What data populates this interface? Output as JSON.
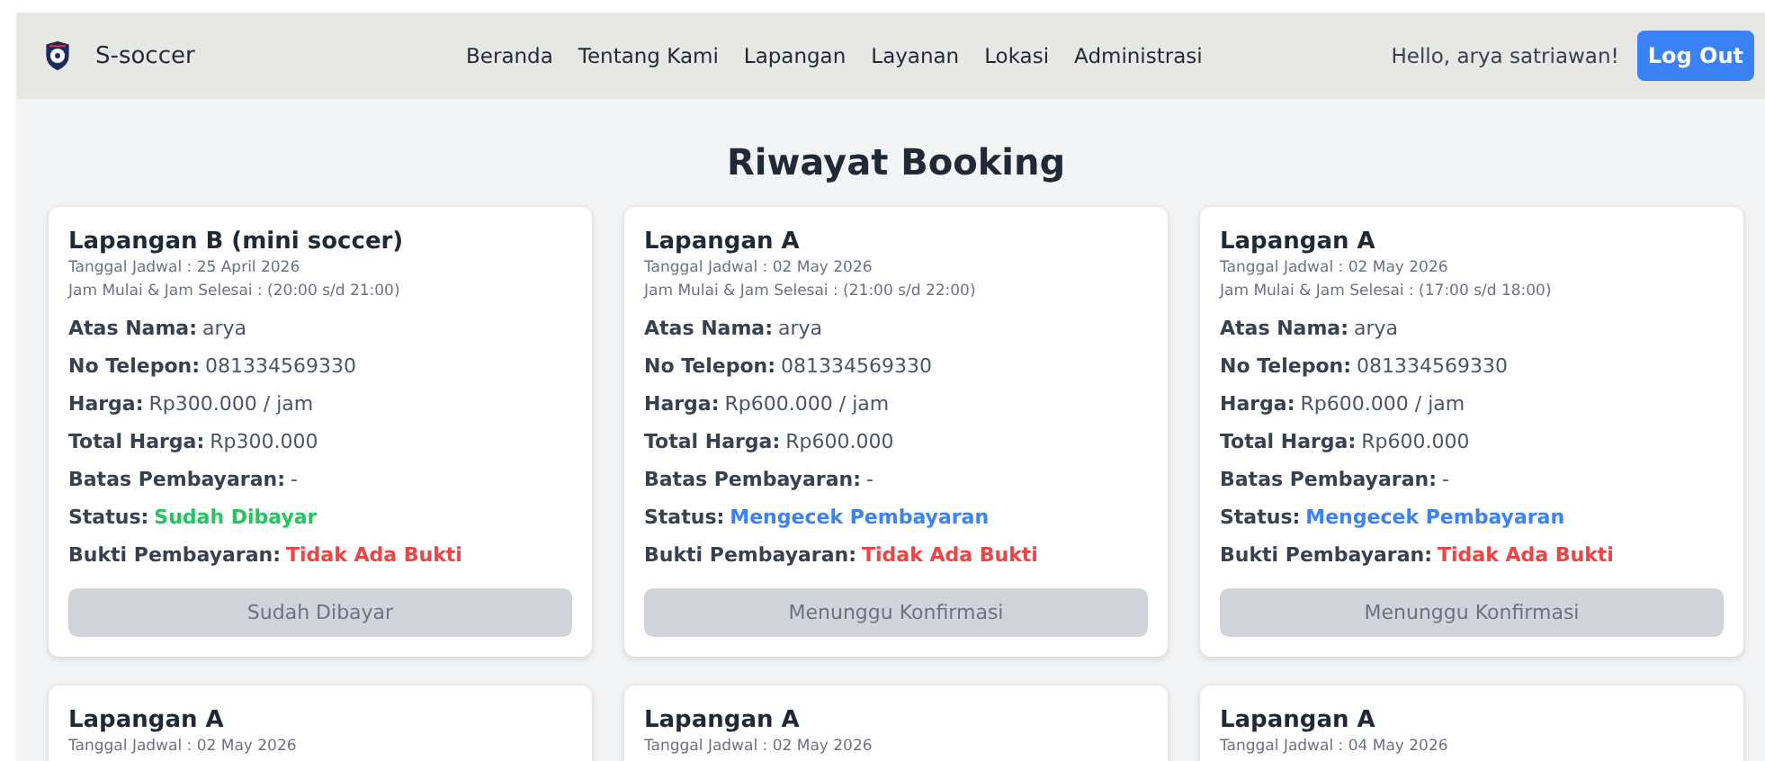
{
  "navbar": {
    "brand": "S-soccer",
    "links": [
      "Beranda",
      "Tentang Kami",
      "Lapangan",
      "Layanan",
      "Lokasi",
      "Administrasi"
    ],
    "greeting": "Hello, arya satriawan!",
    "logout": "Log Out"
  },
  "title": "Riwayat Booking",
  "cards": [
    {
      "title": "Lapangan B (mini soccer)",
      "date": "Tanggal Jadwal : 25 April 2026",
      "time": "Jam Mulai & Jam Selesai : (20:00 s/d 21:00)",
      "fields": [
        {
          "label": "Atas Nama:",
          "value": "arya"
        },
        {
          "label": "No Telepon:",
          "value": "081334569330"
        },
        {
          "label": "Harga:",
          "value": "Rp300.000 / jam"
        },
        {
          "label": "Total Harga:",
          "value": "Rp300.000"
        },
        {
          "label": "Batas Pembayaran:",
          "value": "-"
        },
        {
          "label": "Status:",
          "value": "Sudah Dibayar",
          "color": "#22c55e"
        },
        {
          "label": "Bukti Pembayaran:",
          "value": "Tidak Ada Bukti",
          "color": "#ef4444"
        }
      ],
      "button": "Sudah Dibayar"
    },
    {
      "title": "Lapangan A",
      "date": "Tanggal Jadwal : 02 May 2026",
      "time": "Jam Mulai & Jam Selesai : (21:00 s/d 22:00)",
      "fields": [
        {
          "label": "Atas Nama:",
          "value": "arya"
        },
        {
          "label": "No Telepon:",
          "value": "081334569330"
        },
        {
          "label": "Harga:",
          "value": "Rp600.000 / jam"
        },
        {
          "label": "Total Harga:",
          "value": "Rp600.000"
        },
        {
          "label": "Batas Pembayaran:",
          "value": "-"
        },
        {
          "label": "Status:",
          "value": "Mengecek Pembayaran",
          "color": "#3b82f6"
        },
        {
          "label": "Bukti Pembayaran:",
          "value": "Tidak Ada Bukti",
          "color": "#ef4444"
        }
      ],
      "button": "Menunggu Konfirmasi"
    },
    {
      "title": "Lapangan A",
      "date": "Tanggal Jadwal : 02 May 2026",
      "time": "Jam Mulai & Jam Selesai : (17:00 s/d 18:00)",
      "fields": [
        {
          "label": "Atas Nama:",
          "value": "arya"
        },
        {
          "label": "No Telepon:",
          "value": "081334569330"
        },
        {
          "label": "Harga:",
          "value": "Rp600.000 / jam"
        },
        {
          "label": "Total Harga:",
          "value": "Rp600.000"
        },
        {
          "label": "Batas Pembayaran:",
          "value": "-"
        },
        {
          "label": "Status:",
          "value": "Mengecek Pembayaran",
          "color": "#3b82f6"
        },
        {
          "label": "Bukti Pembayaran:",
          "value": "Tidak Ada Bukti",
          "color": "#ef4444"
        }
      ],
      "button": "Menunggu Konfirmasi"
    },
    {
      "title": "Lapangan A",
      "date": "Tanggal Jadwal : 02 May 2026"
    },
    {
      "title": "Lapangan A",
      "date": "Tanggal Jadwal : 02 May 2026"
    },
    {
      "title": "Lapangan A",
      "date": "Tanggal Jadwal : 04 May 2026"
    }
  ]
}
